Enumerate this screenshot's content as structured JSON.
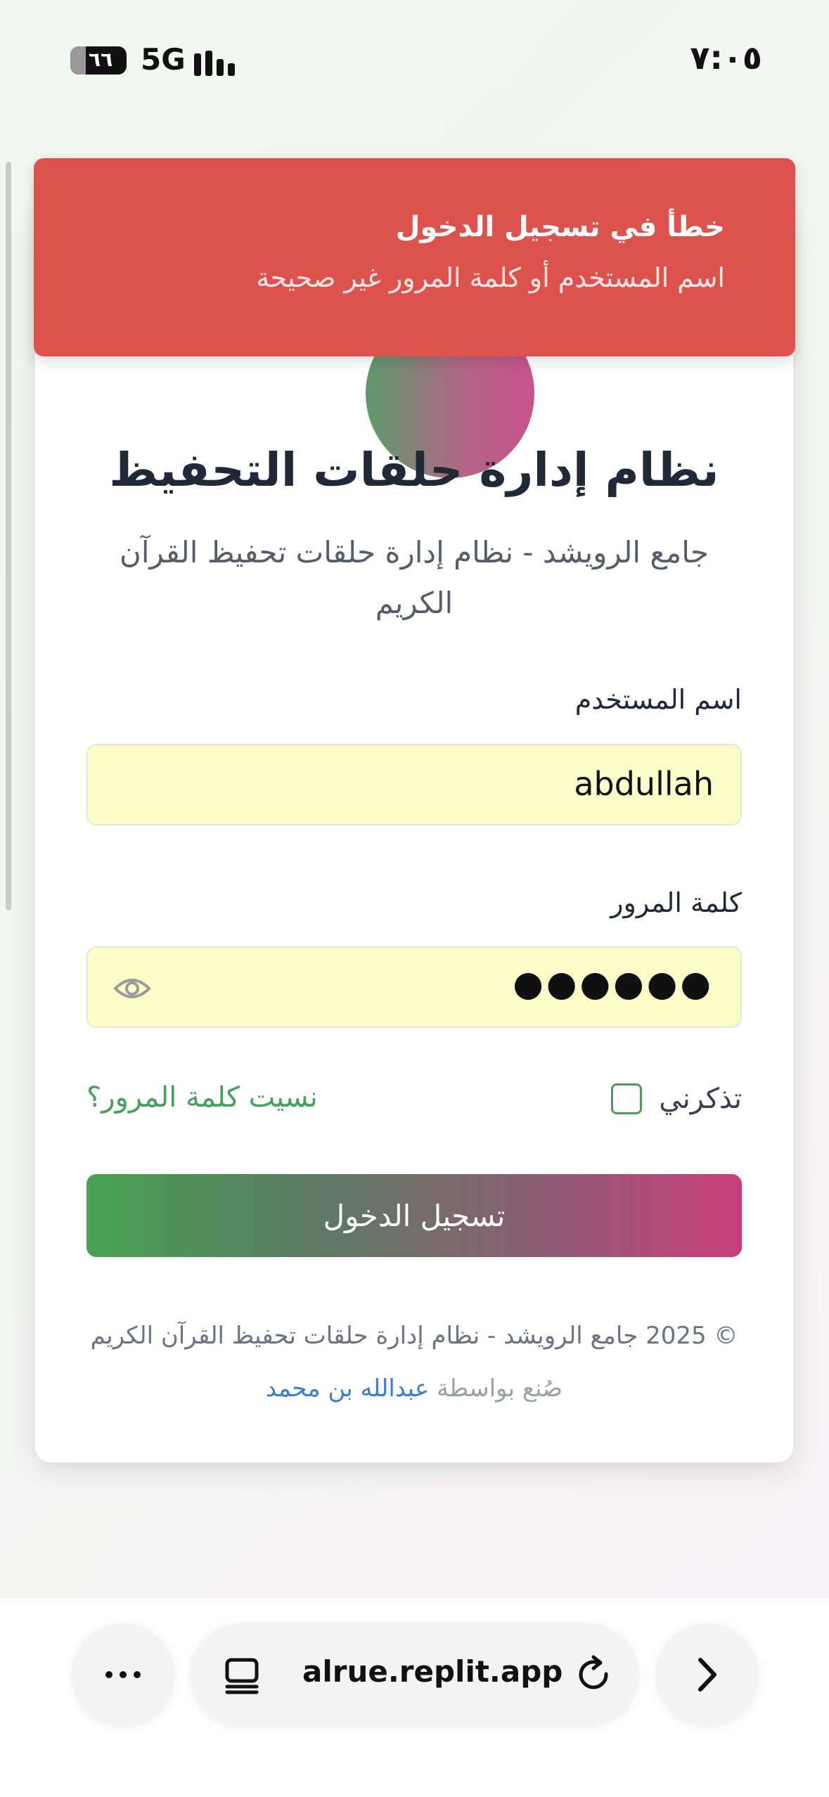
{
  "status_bar": {
    "time": "٧:٠٥",
    "battery": "٦٦",
    "network": "5G"
  },
  "toast": {
    "title": "خطأ في تسجيل الدخول",
    "message": "اسم المستخدم أو كلمة المرور غير صحيحة",
    "color": "#dd524c"
  },
  "login": {
    "title": "نظام إدارة حلقات التحفيظ",
    "subtitle": "جامع الرويشد - نظام إدارة حلقات تحفيظ القرآن الكريم",
    "username_label": "اسم المستخدم",
    "username_value": "abdullah",
    "password_label": "كلمة المرور",
    "password_value": "●●●●●●",
    "remember_label": "تذكرني",
    "forgot_link": "نسيت كلمة المرور؟",
    "submit_label": "تسجيل الدخول",
    "footer": "© 2025 جامع الرويشد - نظام إدارة حلقات تحفيظ القرآن الكريم",
    "credit_prefix": "صُنع بواسطة",
    "credit_author": "عبدالله بن محمد",
    "accent_green": "#45a05a",
    "accent_pink": "#c83e7a"
  },
  "browser": {
    "url": "alrue.replit.app",
    "icons": [
      "more-icon",
      "tabs-icon",
      "reload-icon",
      "forward-icon"
    ]
  }
}
